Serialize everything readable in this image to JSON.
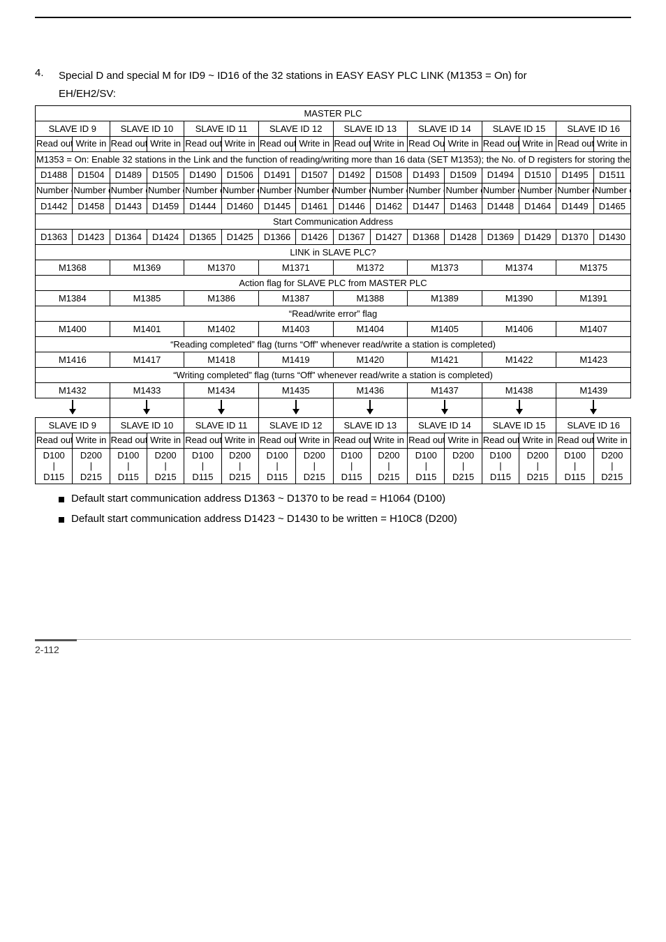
{
  "heading_num": "4.",
  "heading_text": "Special D and special M for ID9 ~ ID16 of the 32 stations in EASY EASY PLC LINK (M1353 = On) for",
  "heading_sub": "EH/EH2/SV:",
  "master": "MASTER PLC",
  "slave": [
    "SLAVE ID 9",
    "SLAVE ID 10",
    "SLAVE ID 11",
    "SLAVE ID 12",
    "SLAVE ID 13",
    "SLAVE ID 14",
    "SLAVE ID 15",
    "SLAVE ID 16"
  ],
  "rw": {
    "ro": "Read out",
    "wi": "Write in",
    "rO2": "Read Out"
  },
  "note1": "M1353 = On: Enable 32 stations in the Link and the function of reading/writing more than 16 data (SET M1353); the No. of D registers for storing the read/written data.",
  "row_d1488": [
    "D1488",
    "D1504",
    "D1489",
    "D1505",
    "D1490",
    "D1506",
    "D1491",
    "D1507",
    "D1492",
    "D1508",
    "D1493",
    "D1509",
    "D1494",
    "D1510",
    "D1495",
    "D1511"
  ],
  "row_num_of_data": "Number of data",
  "row_d1442": [
    "D1442",
    "D1458",
    "D1443",
    "D1459",
    "D1444",
    "D1460",
    "D1445",
    "D1461",
    "D1446",
    "D1462",
    "D1447",
    "D1463",
    "D1448",
    "D1464",
    "D1449",
    "D1465"
  ],
  "start_comm": "Start Communication Address",
  "row_d1363": [
    "D1363",
    "D1423",
    "D1364",
    "D1424",
    "D1365",
    "D1425",
    "D1366",
    "D1426",
    "D1367",
    "D1427",
    "D1368",
    "D1428",
    "D1369",
    "D1429",
    "D1370",
    "D1430"
  ],
  "link_q": "LINK in SLAVE PLC?",
  "row_m1368": [
    "M1368",
    "M1369",
    "M1370",
    "M1371",
    "M1372",
    "M1373",
    "M1374",
    "M1375"
  ],
  "action_flag": "Action flag for SLAVE PLC from MASTER PLC",
  "row_m1384": [
    "M1384",
    "M1385",
    "M1386",
    "M1387",
    "M1388",
    "M1389",
    "M1390",
    "M1391"
  ],
  "rw_err": "“Read/write error” flag",
  "row_m1400": [
    "M1400",
    "M1401",
    "M1402",
    "M1403",
    "M1404",
    "M1405",
    "M1406",
    "M1407"
  ],
  "read_comp": "“Reading completed” flag (turns “Off” whenever read/write a station is completed)",
  "row_m1416": [
    "M1416",
    "M1417",
    "M1418",
    "M1419",
    "M1420",
    "M1421",
    "M1422",
    "M1423"
  ],
  "write_comp": "“Writing completed” flag (turns “Off” whenever read/write a station is completed)",
  "row_m1432": [
    "M1432",
    "M1433",
    "M1434",
    "M1435",
    "M1436",
    "M1437",
    "M1438",
    "M1439"
  ],
  "row_d100": [
    "D100",
    "D200",
    "D100",
    "D200",
    "D100",
    "D200",
    "D100",
    "D200",
    "D100",
    "D200",
    "D100",
    "D200",
    "D100",
    "D200",
    "D100",
    "D200"
  ],
  "row_d115": [
    "D115",
    "D215",
    "D115",
    "D215",
    "D115",
    "D215",
    "D115",
    "D215",
    "D115",
    "D215",
    "D115",
    "D215",
    "D115",
    "D215",
    "D115",
    "D215"
  ],
  "pipe": "|",
  "bullet1": "Default start communication address D1363 ~ D1370 to be read = H1064 (D100)",
  "bullet2": "Default start communication address D1423 ~ D1430 to be written = H10C8 (D200)",
  "page": "2-112"
}
